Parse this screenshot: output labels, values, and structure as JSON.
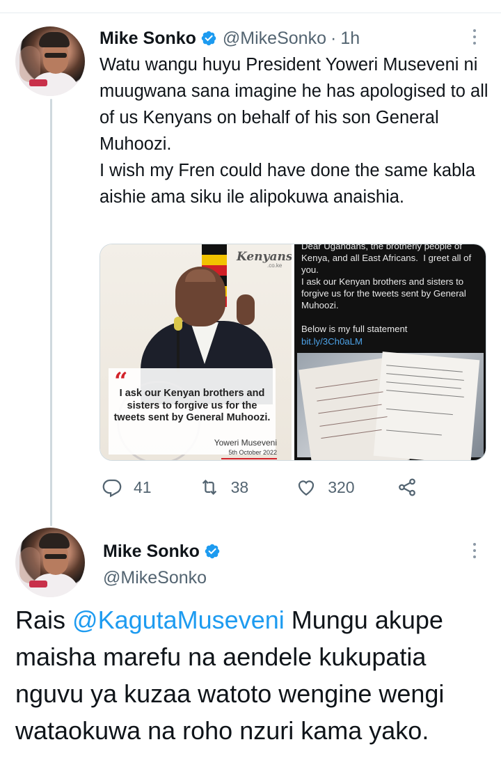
{
  "colors": {
    "accent": "#1d9bf0",
    "secondary_text": "#536471",
    "thread_line": "#cfd9de"
  },
  "tweet1": {
    "author": {
      "display_name": "Mike Sonko",
      "handle": "@MikeSonko",
      "verified": true,
      "avatar_icon": "avatar-photo"
    },
    "separator": "·",
    "time": "1h",
    "text": "Watu wangu huyu President Yoweri Museveni ni muugwana sana imagine he has apologised to all of us Kenyans on behalf of his son General Muhoozi.\nI wish my Fren could have done the same kabla aishie ama siku ile alipokuwa anaishia.",
    "media": {
      "left_image": {
        "logo": "Kenyans",
        "logo_sub": ".co.ke",
        "quote": "I ask our Kenyan brothers and sisters to forgive us for the tweets sent by General Muhoozi.",
        "attribution": "Yoweri Museveni",
        "date": "5th October 2022"
      },
      "right_image": {
        "top_text": "Dear Ugandans, the brotherly people of Kenya, and all East Africans.  I greet all of you.\nI ask our Kenyan brothers and sisters to forgive us for the tweets sent by General Muhoozi.",
        "statement_label": "Below is my full statement",
        "link": "bit.ly/3Ch0aLM"
      }
    },
    "actions": {
      "replies": "41",
      "retweets": "38",
      "likes": "320"
    }
  },
  "tweet2": {
    "author": {
      "display_name": "Mike Sonko",
      "handle": "@MikeSonko",
      "verified": true
    },
    "text_prefix": "Rais ",
    "mention": "@KagutaMuseveni",
    "text_suffix": " Mungu akupe maisha marefu na aendele kukupatia nguvu ya kuzaa watoto wengine wengi wataokuwa na roho nzuri kama yako."
  }
}
